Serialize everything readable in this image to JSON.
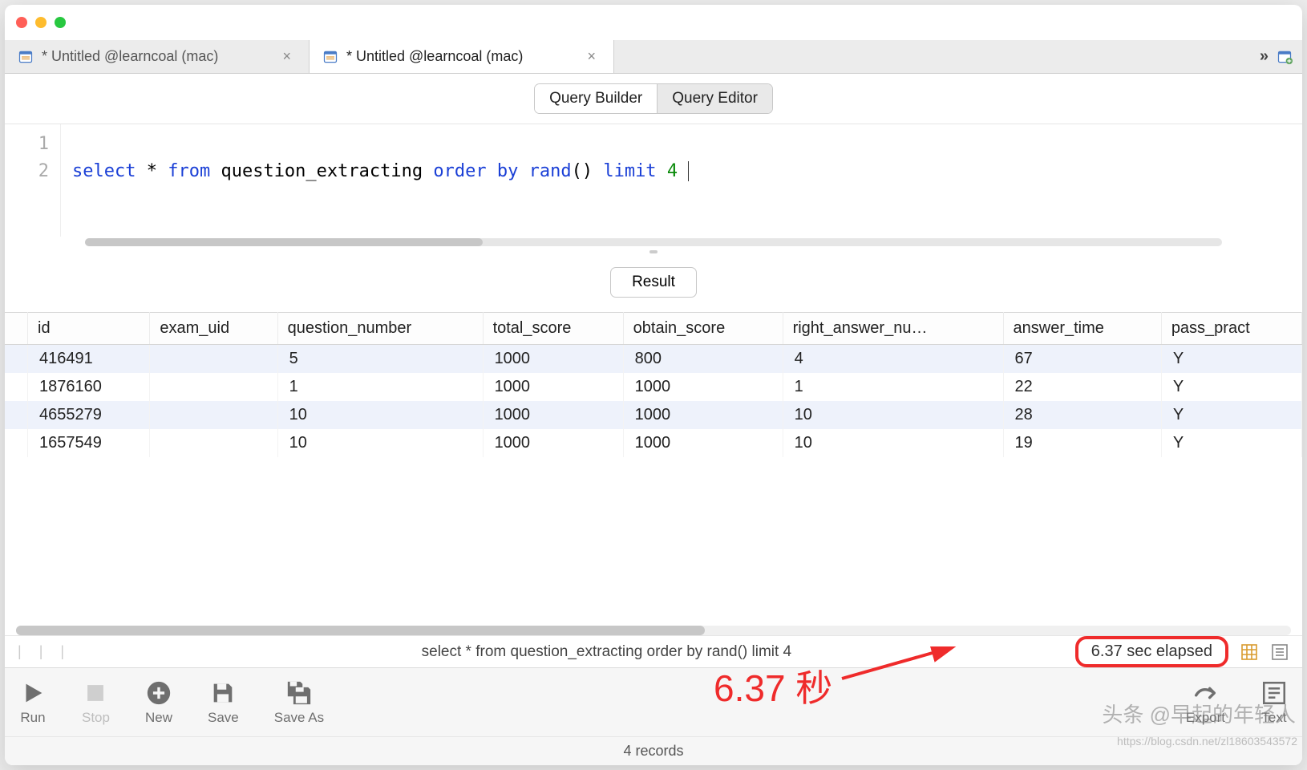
{
  "tabs": [
    {
      "label": "* Untitled @learncoal (mac)",
      "active": false
    },
    {
      "label": "* Untitled @learncoal (mac)",
      "active": true
    }
  ],
  "segmented": {
    "builder": "Query Builder",
    "editor": "Query Editor",
    "active": "editor"
  },
  "editor": {
    "line1_no": "1",
    "line2_no": "2",
    "sql_tokens": {
      "select": "select",
      "star": " * ",
      "from": "from",
      "table": " question_extracting ",
      "order": "order",
      "by": " by ",
      "rand": "rand",
      "paren": "() ",
      "limit": "limit",
      "space": " ",
      "num": "4"
    }
  },
  "result_tab": "Result",
  "columns": [
    "id",
    "exam_uid",
    "question_number",
    "total_score",
    "obtain_score",
    "right_answer_nu…",
    "answer_time",
    "pass_pract"
  ],
  "rows": [
    {
      "id": "416491",
      "exam_uid": "",
      "question_number": "5",
      "total_score": "1000",
      "obtain_score": "800",
      "right_answer_num": "4",
      "answer_time": "67",
      "pass_pract": "Y"
    },
    {
      "id": "1876160",
      "exam_uid": "",
      "question_number": "1",
      "total_score": "1000",
      "obtain_score": "1000",
      "right_answer_num": "1",
      "answer_time": "22",
      "pass_pract": "Y"
    },
    {
      "id": "4655279",
      "exam_uid": "",
      "question_number": "10",
      "total_score": "1000",
      "obtain_score": "1000",
      "right_answer_num": "10",
      "answer_time": "28",
      "pass_pract": "Y"
    },
    {
      "id": "1657549",
      "exam_uid": "",
      "question_number": "10",
      "total_score": "1000",
      "obtain_score": "1000",
      "right_answer_num": "10",
      "answer_time": "19",
      "pass_pract": "Y"
    }
  ],
  "statusbar": {
    "query": "select * from question_extracting order by rand() limit 4",
    "elapsed": "6.37 sec elapsed"
  },
  "toolbar": {
    "run": "Run",
    "stop": "Stop",
    "new": "New",
    "save": "Save",
    "saveas": "Save As",
    "export": "Export",
    "text": "Text"
  },
  "records": "4 records",
  "annotation": "6.37 秒",
  "watermark1": "头条 @早起的年轻人",
  "watermark2": "https://blog.csdn.net/zl18603543572"
}
